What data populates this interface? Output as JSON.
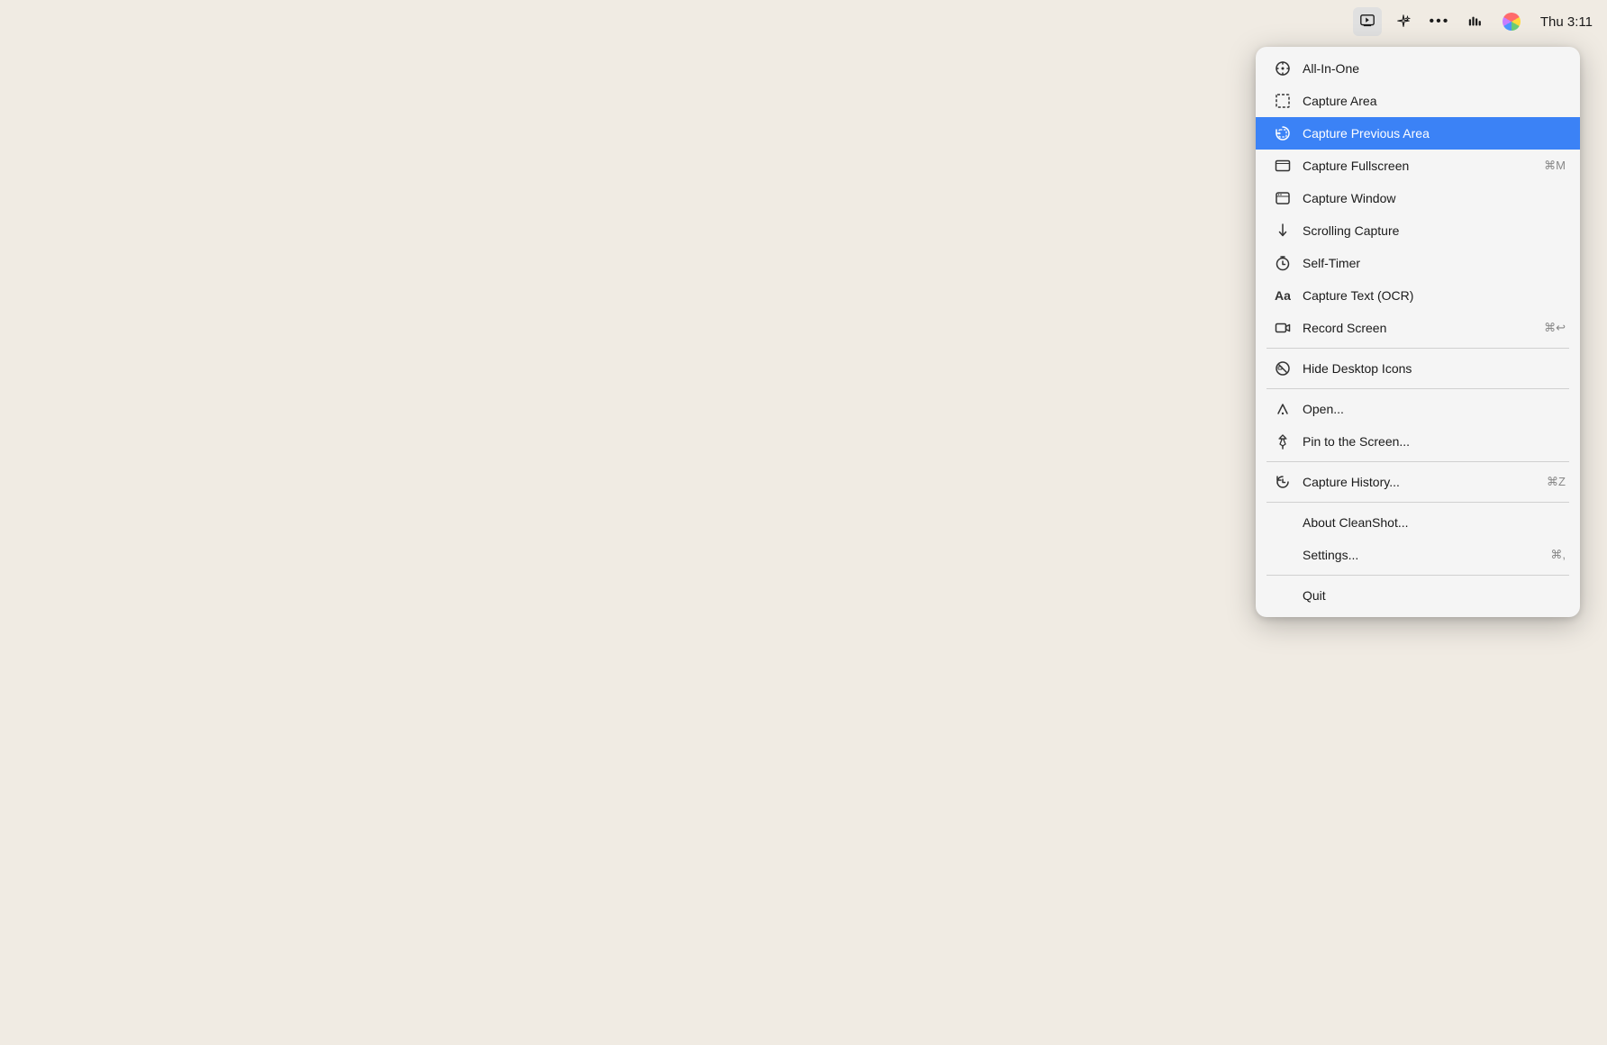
{
  "menubar": {
    "time": "Thu 3:11",
    "icons": [
      {
        "name": "cleanshot-icon",
        "label": "CleanShot",
        "active": true
      },
      {
        "name": "sparkle-icon",
        "label": "Sparkle"
      },
      {
        "name": "dots-icon",
        "label": "More"
      },
      {
        "name": "audio-icon",
        "label": "Audio"
      },
      {
        "name": "siri-icon",
        "label": "Siri"
      }
    ]
  },
  "menu": {
    "items": [
      {
        "id": "all-in-one",
        "label": "All-In-One",
        "icon": "all-in-one-icon",
        "shortcut": "",
        "divider_after": false,
        "highlighted": false
      },
      {
        "id": "capture-area",
        "label": "Capture Area",
        "icon": "capture-area-icon",
        "shortcut": "",
        "divider_after": false,
        "highlighted": false
      },
      {
        "id": "capture-previous-area",
        "label": "Capture Previous Area",
        "icon": "capture-previous-icon",
        "shortcut": "",
        "divider_after": false,
        "highlighted": true
      },
      {
        "id": "capture-fullscreen",
        "label": "Capture Fullscreen",
        "icon": "capture-fullscreen-icon",
        "shortcut": "⌘M",
        "divider_after": false,
        "highlighted": false
      },
      {
        "id": "capture-window",
        "label": "Capture Window",
        "icon": "capture-window-icon",
        "shortcut": "",
        "divider_after": false,
        "highlighted": false
      },
      {
        "id": "scrolling-capture",
        "label": "Scrolling Capture",
        "icon": "scrolling-capture-icon",
        "shortcut": "",
        "divider_after": false,
        "highlighted": false
      },
      {
        "id": "self-timer",
        "label": "Self-Timer",
        "icon": "self-timer-icon",
        "shortcut": "",
        "divider_after": false,
        "highlighted": false
      },
      {
        "id": "capture-text",
        "label": "Capture Text (OCR)",
        "icon": "capture-text-icon",
        "shortcut": "",
        "divider_after": false,
        "highlighted": false
      },
      {
        "id": "record-screen",
        "label": "Record Screen",
        "icon": "record-screen-icon",
        "shortcut": "⌘↩",
        "divider_after": true,
        "highlighted": false
      },
      {
        "id": "hide-desktop-icons",
        "label": "Hide Desktop Icons",
        "icon": "hide-desktop-icon",
        "shortcut": "",
        "divider_after": true,
        "highlighted": false
      },
      {
        "id": "open",
        "label": "Open...",
        "icon": "open-icon",
        "shortcut": "",
        "divider_after": false,
        "highlighted": false
      },
      {
        "id": "pin-to-screen",
        "label": "Pin to the Screen...",
        "icon": "pin-icon",
        "shortcut": "",
        "divider_after": true,
        "highlighted": false
      },
      {
        "id": "capture-history",
        "label": "Capture History...",
        "icon": "history-icon",
        "shortcut": "⌘Z",
        "divider_after": true,
        "highlighted": false
      },
      {
        "id": "about",
        "label": "About CleanShot...",
        "icon": "",
        "shortcut": "",
        "divider_after": false,
        "highlighted": false,
        "no_icon": true
      },
      {
        "id": "settings",
        "label": "Settings...",
        "icon": "",
        "shortcut": "⌘,",
        "divider_after": true,
        "highlighted": false,
        "no_icon": true
      },
      {
        "id": "quit",
        "label": "Quit",
        "icon": "",
        "shortcut": "",
        "divider_after": false,
        "highlighted": false,
        "no_icon": true
      }
    ]
  }
}
